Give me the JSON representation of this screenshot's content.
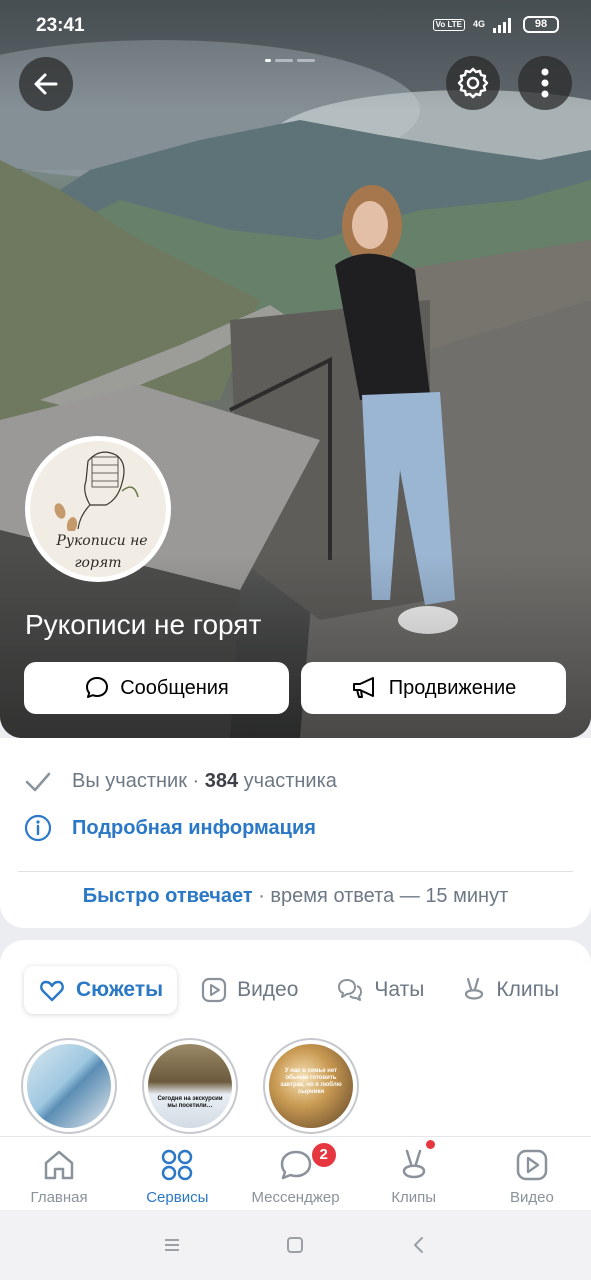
{
  "status_bar": {
    "time": "23:41",
    "volte": "Vo LTE",
    "network": "4G",
    "battery": "98"
  },
  "group": {
    "name": "Рукописи не горят",
    "avatar_text_line1": "Рукописи не",
    "avatar_text_line2": "горят"
  },
  "actions": {
    "messages_label": "Сообщения",
    "promotion_label": "Продвижение"
  },
  "info": {
    "member_status": "Вы участник",
    "separator": " · ",
    "member_count": "384",
    "member_word": "участника",
    "details_label": "Подробная информация",
    "fast_reply": "Быстро отвечает",
    "reply_time": " · время ответа — 15 минут"
  },
  "content_tabs": [
    {
      "label": "Сюжеты",
      "icon": "heart-story-icon",
      "active": true
    },
    {
      "label": "Видео",
      "icon": "video-icon",
      "active": false
    },
    {
      "label": "Чаты",
      "icon": "chats-icon",
      "active": false
    },
    {
      "label": "Клипы",
      "icon": "clips-icon",
      "active": false
    }
  ],
  "stories": [
    {
      "caption": ""
    },
    {
      "caption": "Сегодня на экскурсии мы посетили…"
    },
    {
      "caption": "У нас в семье нет обычая готовить завтрак, но я люблю сырники"
    }
  ],
  "bottom_nav": [
    {
      "label": "Главная",
      "icon": "home-icon",
      "active": false
    },
    {
      "label": "Сервисы",
      "icon": "services-icon",
      "active": true
    },
    {
      "label": "Мессенджер",
      "icon": "messenger-icon",
      "active": false,
      "badge": "2"
    },
    {
      "label": "Клипы",
      "icon": "clips-icon",
      "active": false,
      "dot": true
    },
    {
      "label": "Видео",
      "icon": "video-icon",
      "active": false
    }
  ],
  "colors": {
    "accent": "#2a78c6",
    "badge": "#e6363f",
    "muted": "#6d7885"
  }
}
